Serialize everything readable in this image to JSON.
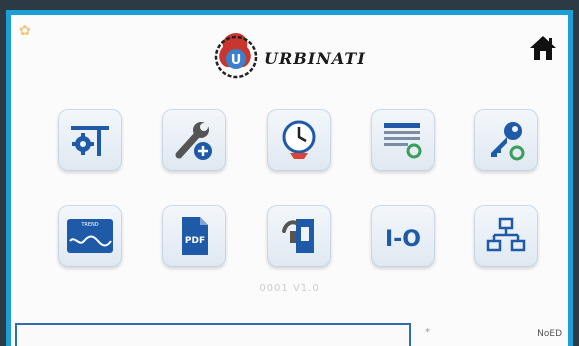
{
  "brand": {
    "name": "URBINATI",
    "emblem_letter": "U"
  },
  "icons": {
    "home": "home-icon",
    "row1": [
      "machine-settings-icon",
      "service-tools-icon",
      "timer-clock-icon",
      "schedule-icon",
      "access-key-icon"
    ],
    "row2": [
      "wave-graph-icon",
      "pdf-document-icon",
      "manual-icon",
      "input-output-icon",
      "network-icon"
    ]
  },
  "tile_labels": {
    "pdf": "PDF",
    "io": "I-O",
    "wave_caption": "TREND"
  },
  "footer": {
    "serial": "0001 V1.0",
    "marker": "*",
    "right_text": "NoED"
  },
  "colors": {
    "frame": "#1b9fd4",
    "icon_blue": "#1f5aa8",
    "icon_green": "#3a9e5c",
    "accent_red": "#d9443a"
  }
}
